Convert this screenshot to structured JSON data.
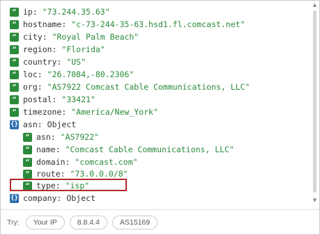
{
  "rows": [
    {
      "badge": "string",
      "key": "ip",
      "value": "\"73.244.35.63\""
    },
    {
      "badge": "string",
      "key": "hostname",
      "value": "\"c-73-244-35-63.hsd1.fl.comcast.net\""
    },
    {
      "badge": "string",
      "key": "city",
      "value": "\"Royal Palm Beach\""
    },
    {
      "badge": "string",
      "key": "region",
      "value": "\"Florida\""
    },
    {
      "badge": "string",
      "key": "country",
      "value": "\"US\""
    },
    {
      "badge": "string",
      "key": "loc",
      "value": "\"26.7084,-80.2306\""
    },
    {
      "badge": "string",
      "key": "org",
      "value": "\"AS7922 Comcast Cable Communications, LLC\""
    },
    {
      "badge": "string",
      "key": "postal",
      "value": "\"33421\""
    },
    {
      "badge": "string",
      "key": "timezone",
      "value": "\"America/New_York\""
    },
    {
      "badge": "object",
      "key": "asn",
      "value": "Object"
    },
    {
      "badge": "string",
      "key": "asn",
      "value": "\"AS7922\""
    },
    {
      "badge": "string",
      "key": "name",
      "value": "\"Comcast Cable Communications, LLC\""
    },
    {
      "badge": "string",
      "key": "domain",
      "value": "\"comcast.com\""
    },
    {
      "badge": "string",
      "key": "route",
      "value": "\"73.0.0.0/8\""
    },
    {
      "badge": "string",
      "key": "type",
      "value": "\"isp\""
    },
    {
      "badge": "object",
      "key": "company",
      "value": "Object"
    }
  ],
  "icons": {
    "string": {
      "glyph": "“",
      "color": "#2a8a3a",
      "name": "string-type-icon"
    },
    "object": {
      "glyph": "{}",
      "color": "#2f6fb0",
      "name": "object-type-icon"
    }
  },
  "highlight_color": "#b22a2a",
  "footer": {
    "try_label": "Try:",
    "examples": [
      "Your IP",
      "8.8.4.4",
      "AS15169"
    ]
  }
}
